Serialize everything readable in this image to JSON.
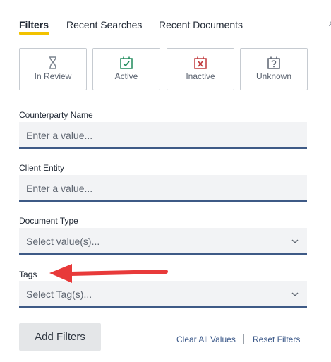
{
  "tabs": [
    {
      "label": "Filters",
      "active": true
    },
    {
      "label": "Recent Searches",
      "active": false
    },
    {
      "label": "Recent Documents",
      "active": false
    }
  ],
  "tab_overflow": "A",
  "accent_color": "#f2c200",
  "status_buttons": [
    {
      "label": "In Review",
      "icon": "hourglass-icon",
      "color": "#7d8590"
    },
    {
      "label": "Active",
      "icon": "calendar-check-icon",
      "color": "#1f8a5b"
    },
    {
      "label": "Inactive",
      "icon": "calendar-x-icon",
      "color": "#c0393b"
    },
    {
      "label": "Unknown",
      "icon": "calendar-question-icon",
      "color": "#5b6370"
    }
  ],
  "fields": [
    {
      "label": "Counterparty Name",
      "placeholder": "Enter a value..."
    },
    {
      "label": "Client Entity",
      "placeholder": "Enter a value..."
    },
    {
      "label": "Document Type",
      "placeholder": "Select value(s)..."
    },
    {
      "label": "Tags",
      "placeholder": "Select Tag(s)..."
    }
  ],
  "actions": {
    "add_filters": "Add Filters",
    "clear_all": "Clear All Values",
    "reset": "Reset Filters"
  },
  "annotation_arrow_color": "#e83a3a"
}
